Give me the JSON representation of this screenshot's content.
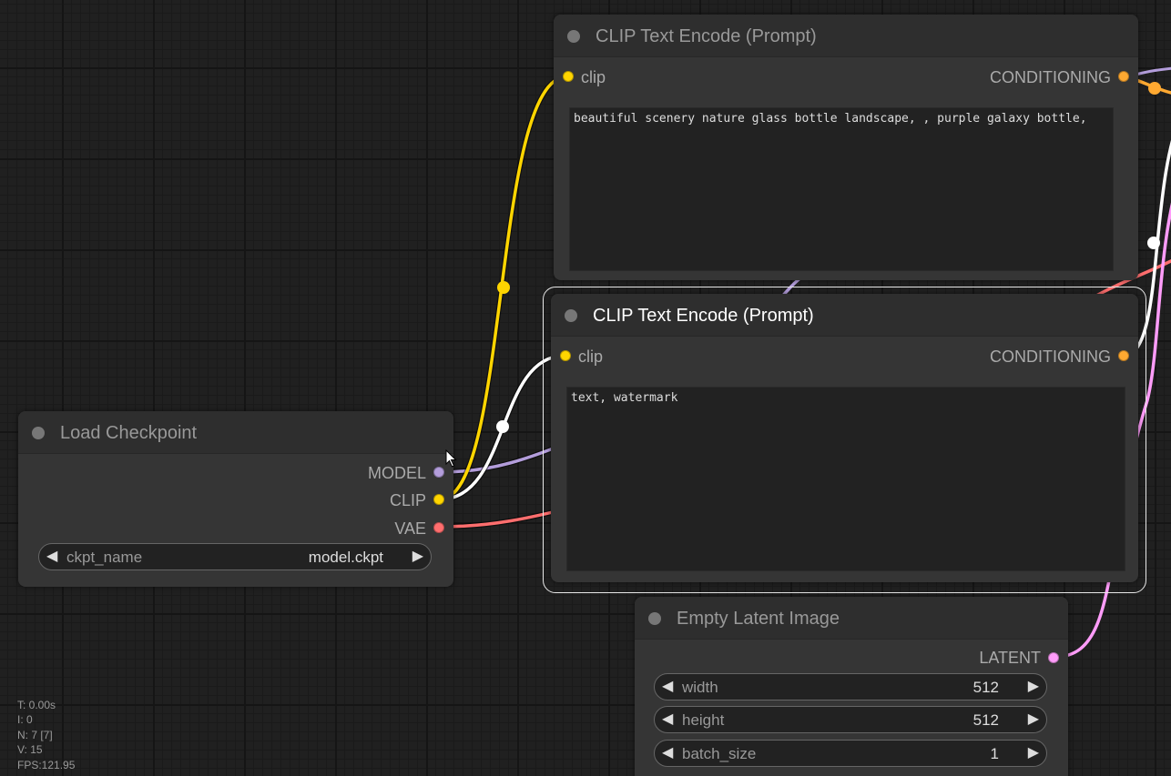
{
  "colors": {
    "clip": "#FFD500",
    "model": "#B39DDB",
    "vae": "#FF6E6E",
    "conditioning": "#FFA931",
    "latent": "#FF9CF9",
    "selection": "#FFFFFF"
  },
  "nodes": {
    "clip_text_encode_positive": {
      "title": "CLIP Text Encode (Prompt)",
      "input_clip": "clip",
      "output_conditioning": "CONDITIONING",
      "text": "beautiful scenery nature glass bottle landscape, , purple galaxy bottle,"
    },
    "clip_text_encode_negative": {
      "title": "CLIP Text Encode (Prompt)",
      "input_clip": "clip",
      "output_conditioning": "CONDITIONING",
      "text": "text, watermark"
    },
    "load_checkpoint": {
      "title": "Load Checkpoint",
      "output_model": "MODEL",
      "output_clip": "CLIP",
      "output_vae": "VAE",
      "ckpt_name_label": "ckpt_name",
      "ckpt_name_value": "model.ckpt"
    },
    "empty_latent_image": {
      "title": "Empty Latent Image",
      "output_latent": "LATENT",
      "width_label": "width",
      "width_value": "512",
      "height_label": "height",
      "height_value": "512",
      "batch_size_label": "batch_size",
      "batch_size_value": "1"
    }
  },
  "widget_arrows": {
    "left": "◀",
    "right": "▶"
  },
  "stats": {
    "time": "T: 0.00s",
    "i": "I: 0",
    "nodes": "N: 7 [7]",
    "vertices": "V: 15",
    "fps": "FPS:121.95"
  }
}
